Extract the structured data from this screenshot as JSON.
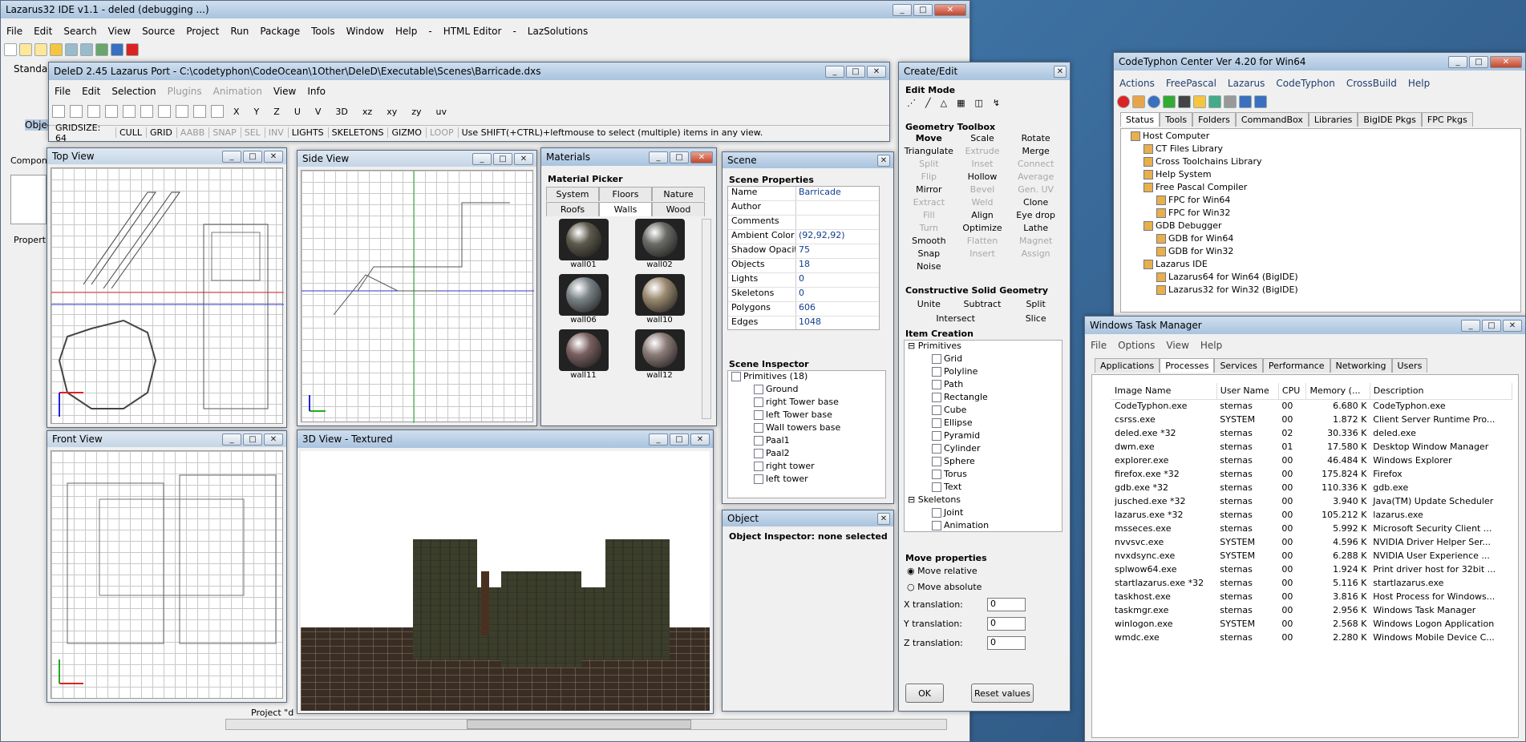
{
  "lazarus": {
    "title": "Lazarus32 IDE v1.1 - deled (debugging ...)",
    "menu": [
      "File",
      "Edit",
      "Search",
      "View",
      "Source",
      "Project",
      "Run",
      "Package",
      "Tools",
      "Window",
      "Help",
      "-",
      "HTML Editor",
      "-",
      "LazSolutions"
    ],
    "standard": "Standard",
    "object": "Objec",
    "components": "Compon",
    "properties": "Propert",
    "project_label": "Project \"d"
  },
  "deled": {
    "title": "DeleD 2.45 Lazarus Port - C:\\codetyphon\\CodeOcean\\1Other\\DeleD\\Executable\\Scenes\\Barricade.dxs",
    "menu": [
      "File",
      "Edit",
      "Selection",
      "Plugins",
      "Animation",
      "View",
      "Info"
    ],
    "menu_disabled": [
      "Plugins",
      "Animation"
    ],
    "axes": [
      "X",
      "Y",
      "Z",
      "U",
      "V",
      "3D",
      "xz",
      "xy",
      "zy",
      "uv"
    ],
    "status": {
      "gridsize": "GRIDSIZE: 64",
      "toggles": [
        "CULL",
        "GRID",
        "AABB",
        "SNAP",
        "SEL",
        "INV",
        "LIGHTS",
        "SKELETONS",
        "GIZMO",
        "LOOP"
      ],
      "disabled": [
        "AABB",
        "SNAP",
        "SEL",
        "INV",
        "LOOP"
      ],
      "hint": "Use SHIFT(+CTRL)+leftmouse to select (multiple) items in any view."
    }
  },
  "views": {
    "top": "Top View",
    "side": "Side View",
    "front": "Front View",
    "view3d": "3D View - Textured"
  },
  "materials": {
    "title": "Materials",
    "picker": "Material Picker",
    "tabs_row1": [
      "System",
      "Floors",
      "Nature"
    ],
    "tabs_row2": [
      "Roofs",
      "Walls",
      "Wood"
    ],
    "items": [
      "wall01",
      "wall02",
      "wall06",
      "wall10",
      "wall11",
      "wall12"
    ],
    "colors": [
      "#5c5a4c",
      "#6a6a66",
      "#7c8488",
      "#9b8a70",
      "#7a6060",
      "#8c7c78"
    ]
  },
  "scene": {
    "title": "Scene",
    "props_header": "Scene Properties",
    "props": [
      {
        "k": "Name",
        "v": "Barricade"
      },
      {
        "k": "Author",
        "v": ""
      },
      {
        "k": "Comments",
        "v": ""
      },
      {
        "k": "Ambient Color",
        "v": "(92,92,92)"
      },
      {
        "k": "Shadow Opacity",
        "v": "75"
      },
      {
        "k": "Objects",
        "v": "18"
      },
      {
        "k": "Lights",
        "v": "0"
      },
      {
        "k": "Skeletons",
        "v": "0"
      },
      {
        "k": "Polygons",
        "v": "606"
      },
      {
        "k": "Edges",
        "v": "1048"
      }
    ],
    "inspector_header": "Scene Inspector",
    "tree": [
      "Primitives (18)",
      "Ground",
      "right Tower base",
      "left Tower base",
      "Wall towers base",
      "Paal1",
      "Paal2",
      "right tower",
      "left tower"
    ]
  },
  "object": {
    "title": "Object",
    "inspector": "Object Inspector: none selected"
  },
  "create": {
    "title": "Create/Edit",
    "edit_mode": "Edit Mode",
    "geometry": "Geometry Toolbox",
    "tools": [
      {
        "t": "Move",
        "s": "b"
      },
      {
        "t": "Scale",
        "s": "n"
      },
      {
        "t": "Rotate",
        "s": "n"
      },
      {
        "t": "Triangulate",
        "s": "n"
      },
      {
        "t": "Extrude",
        "s": "d"
      },
      {
        "t": "Merge",
        "s": "n"
      },
      {
        "t": "Split",
        "s": "d"
      },
      {
        "t": "Inset",
        "s": "d"
      },
      {
        "t": "Connect",
        "s": "d"
      },
      {
        "t": "Flip",
        "s": "d"
      },
      {
        "t": "Hollow",
        "s": "n"
      },
      {
        "t": "Average",
        "s": "d"
      },
      {
        "t": "Mirror",
        "s": "n"
      },
      {
        "t": "Bevel",
        "s": "d"
      },
      {
        "t": "Gen. UV",
        "s": "d"
      },
      {
        "t": "Extract",
        "s": "d"
      },
      {
        "t": "Weld",
        "s": "d"
      },
      {
        "t": "Clone",
        "s": "n"
      },
      {
        "t": "Fill",
        "s": "d"
      },
      {
        "t": "Align",
        "s": "n"
      },
      {
        "t": "Eye drop",
        "s": "n"
      },
      {
        "t": "Turn",
        "s": "d"
      },
      {
        "t": "Optimize",
        "s": "n"
      },
      {
        "t": "Lathe",
        "s": "n"
      },
      {
        "t": "Smooth",
        "s": "n"
      },
      {
        "t": "Flatten",
        "s": "d"
      },
      {
        "t": "Magnet",
        "s": "d"
      },
      {
        "t": "Snap",
        "s": "n"
      },
      {
        "t": "Insert",
        "s": "d"
      },
      {
        "t": "Assign",
        "s": "d"
      },
      {
        "t": "Noise",
        "s": "n"
      }
    ],
    "csg": "Constructive Solid Geometry",
    "csg_ops": [
      "Unite",
      "Subtract",
      "Split",
      "Intersect",
      "Slice"
    ],
    "item_creation": "Item Creation",
    "primitives_label": "Primitives",
    "primitives": [
      "Grid",
      "Polyline",
      "Path",
      "Rectangle",
      "Cube",
      "Ellipse",
      "Pyramid",
      "Cylinder",
      "Sphere",
      "Torus",
      "Text"
    ],
    "skeletons_label": "Skeletons",
    "skeletons": [
      "Joint",
      "Animation"
    ],
    "move_props": "Move properties",
    "move_relative": "Move relative",
    "move_absolute": "Move absolute",
    "x_label": "X translation:",
    "y_label": "Y translation:",
    "z_label": "Z translation:",
    "x_val": "0",
    "y_val": "0",
    "z_val": "0",
    "ok": "OK",
    "reset": "Reset values"
  },
  "ctc": {
    "title": "CodeTyphon Center Ver 4.20 for Win64",
    "menu": [
      "Actions",
      "FreePascal",
      "Lazarus",
      "CodeTyphon",
      "CrossBuild",
      "Help"
    ],
    "tabs": [
      "Status",
      "Tools",
      "Folders",
      "CommandBox",
      "Libraries",
      "BigIDE Pkgs",
      "FPC Pkgs"
    ],
    "tree": [
      {
        "t": "Host Computer",
        "l": 0
      },
      {
        "t": "CT Files Library",
        "l": 1
      },
      {
        "t": "Cross Toolchains Library",
        "l": 1
      },
      {
        "t": "Help System",
        "l": 1
      },
      {
        "t": "Free Pascal Compiler",
        "l": 1
      },
      {
        "t": "FPC for Win64",
        "l": 2
      },
      {
        "t": "FPC for Win32",
        "l": 2
      },
      {
        "t": "GDB Debugger",
        "l": 1
      },
      {
        "t": "GDB for Win64",
        "l": 2
      },
      {
        "t": "GDB for Win32",
        "l": 2
      },
      {
        "t": "Lazarus IDE",
        "l": 1
      },
      {
        "t": "Lazarus64 for Win64 (BigIDE)",
        "l": 2
      },
      {
        "t": "Lazarus32 for Win32 (BigIDE)",
        "l": 2
      }
    ]
  },
  "taskmgr": {
    "title": "Windows Task Manager",
    "menu": [
      "File",
      "Options",
      "View",
      "Help"
    ],
    "tabs": [
      "Applications",
      "Processes",
      "Services",
      "Performance",
      "Networking",
      "Users"
    ],
    "active_tab": "Processes",
    "columns": [
      "Image Name",
      "User Name",
      "CPU",
      "Memory (...",
      "Description"
    ],
    "rows": [
      [
        "CodeTyphon.exe",
        "sternas",
        "00",
        "6.680 K",
        "CodeTyphon.exe"
      ],
      [
        "csrss.exe",
        "SYSTEM",
        "00",
        "1.872 K",
        "Client Server Runtime Pro..."
      ],
      [
        "deled.exe *32",
        "sternas",
        "02",
        "30.336 K",
        "deled.exe"
      ],
      [
        "dwm.exe",
        "sternas",
        "01",
        "17.580 K",
        "Desktop Window Manager"
      ],
      [
        "explorer.exe",
        "sternas",
        "00",
        "46.484 K",
        "Windows Explorer"
      ],
      [
        "firefox.exe *32",
        "sternas",
        "00",
        "175.824 K",
        "Firefox"
      ],
      [
        "gdb.exe *32",
        "sternas",
        "00",
        "110.336 K",
        "gdb.exe"
      ],
      [
        "jusched.exe *32",
        "sternas",
        "00",
        "3.940 K",
        "Java(TM) Update Scheduler"
      ],
      [
        "lazarus.exe *32",
        "sternas",
        "00",
        "105.212 K",
        "lazarus.exe"
      ],
      [
        "msseces.exe",
        "sternas",
        "00",
        "5.992 K",
        "Microsoft Security Client ..."
      ],
      [
        "nvvsvc.exe",
        "SYSTEM",
        "00",
        "4.596 K",
        "NVIDIA Driver Helper Ser..."
      ],
      [
        "nvxdsync.exe",
        "SYSTEM",
        "00",
        "6.288 K",
        "NVIDIA User Experience ..."
      ],
      [
        "splwow64.exe",
        "sternas",
        "00",
        "1.924 K",
        "Print driver host for 32bit ..."
      ],
      [
        "startlazarus.exe *32",
        "sternas",
        "00",
        "5.116 K",
        "startlazarus.exe"
      ],
      [
        "taskhost.exe",
        "sternas",
        "00",
        "3.816 K",
        "Host Process for Windows..."
      ],
      [
        "taskmgr.exe",
        "sternas",
        "00",
        "2.956 K",
        "Windows Task Manager"
      ],
      [
        "winlogon.exe",
        "SYSTEM",
        "00",
        "2.568 K",
        "Windows Logon Application"
      ],
      [
        "wmdc.exe",
        "sternas",
        "00",
        "2.280 K",
        "Windows Mobile Device C..."
      ]
    ]
  },
  "ghost_text": "Project \"d"
}
